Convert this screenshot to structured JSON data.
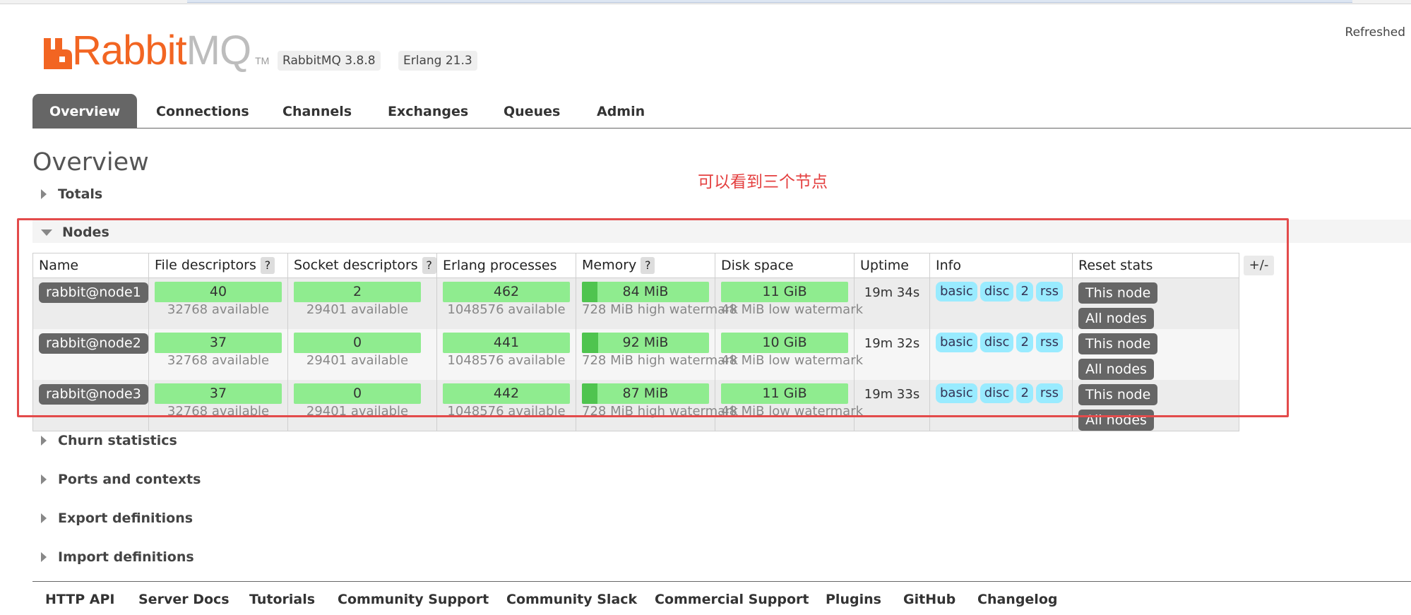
{
  "header": {
    "logo_main": "Rabbit",
    "logo_mq": "MQ",
    "logo_tm": "TM",
    "version_rabbitmq": "RabbitMQ 3.8.8",
    "version_erlang": "Erlang 21.3",
    "refreshed": "Refreshed",
    "brand_color": "#f26522"
  },
  "tabs": [
    {
      "label": "Overview",
      "active": true
    },
    {
      "label": "Connections"
    },
    {
      "label": "Channels"
    },
    {
      "label": "Exchanges"
    },
    {
      "label": "Queues"
    },
    {
      "label": "Admin"
    }
  ],
  "page_title": "Overview",
  "annotation": "可以看到三个节点",
  "sections": {
    "totals": "Totals",
    "nodes": "Nodes",
    "churn": "Churn statistics",
    "ports": "Ports and contexts",
    "export": "Export definitions",
    "import": "Import definitions"
  },
  "nodes_table": {
    "columns": {
      "name": "Name",
      "file_descriptors": "File descriptors",
      "socket_descriptors": "Socket descriptors",
      "erlang_processes": "Erlang processes",
      "memory": "Memory",
      "disk_space": "Disk space",
      "uptime": "Uptime",
      "info": "Info",
      "reset_stats": "Reset stats"
    },
    "help_label": "?",
    "plus_minus": "+/-",
    "rows": [
      {
        "name": "rabbit@node1",
        "fd": "40",
        "fd_avail": "32768 available",
        "sd": "2",
        "sd_avail": "29401 available",
        "ep": "462",
        "ep_avail": "1048576 available",
        "mem": "84 MiB",
        "mem_wm": "728 MiB high watermark",
        "mem_fraction": 0.12,
        "disk": "11 GiB",
        "disk_wm": "48 MiB low watermark",
        "uptime": "19m 34s",
        "info": [
          "basic",
          "disc",
          "2",
          "rss"
        ],
        "reset_this": "This node",
        "reset_all": "All nodes"
      },
      {
        "name": "rabbit@node2",
        "fd": "37",
        "fd_avail": "32768 available",
        "sd": "0",
        "sd_avail": "29401 available",
        "ep": "441",
        "ep_avail": "1048576 available",
        "mem": "92 MiB",
        "mem_wm": "728 MiB high watermark",
        "mem_fraction": 0.13,
        "disk": "10 GiB",
        "disk_wm": "48 MiB low watermark",
        "uptime": "19m 32s",
        "info": [
          "basic",
          "disc",
          "2",
          "rss"
        ],
        "reset_this": "This node",
        "reset_all": "All nodes"
      },
      {
        "name": "rabbit@node3",
        "fd": "37",
        "fd_avail": "32768 available",
        "sd": "0",
        "sd_avail": "29401 available",
        "ep": "442",
        "ep_avail": "1048576 available",
        "mem": "87 MiB",
        "mem_wm": "728 MiB high watermark",
        "mem_fraction": 0.12,
        "disk": "11 GiB",
        "disk_wm": "48 MiB low watermark",
        "uptime": "19m 33s",
        "info": [
          "basic",
          "disc",
          "2",
          "rss"
        ],
        "reset_this": "This node",
        "reset_all": "All nodes"
      }
    ]
  },
  "footer": [
    "HTTP API",
    "Server Docs",
    "Tutorials",
    "Community Support",
    "Community Slack",
    "Commercial Support",
    "Plugins",
    "GitHub",
    "Changelog"
  ]
}
